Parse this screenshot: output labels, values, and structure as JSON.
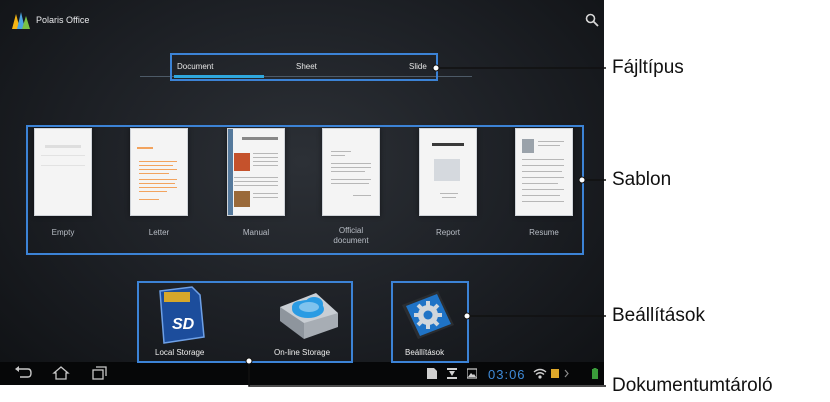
{
  "app": {
    "title": "Polaris Office"
  },
  "tabs": [
    {
      "label": "Document"
    },
    {
      "label": "Sheet"
    },
    {
      "label": "Slide"
    }
  ],
  "templates": [
    {
      "label": "Empty"
    },
    {
      "label": "Letter"
    },
    {
      "label": "Manual"
    },
    {
      "label": "Official\ndocument"
    },
    {
      "label": "Report"
    },
    {
      "label": "Resume"
    }
  ],
  "storage": [
    {
      "label": "Local Storage"
    },
    {
      "label": "On-line Storage"
    },
    {
      "label": "Beállítások"
    }
  ],
  "statusbar": {
    "clock": "03:06"
  },
  "annotations": {
    "file_type": "Fájltípus",
    "template": "Sablon",
    "settings": "Beállítások",
    "storage": "Dokumentumtároló"
  },
  "colors": {
    "accent": "#2fa8de",
    "highlight_box": "#3c83d6"
  }
}
